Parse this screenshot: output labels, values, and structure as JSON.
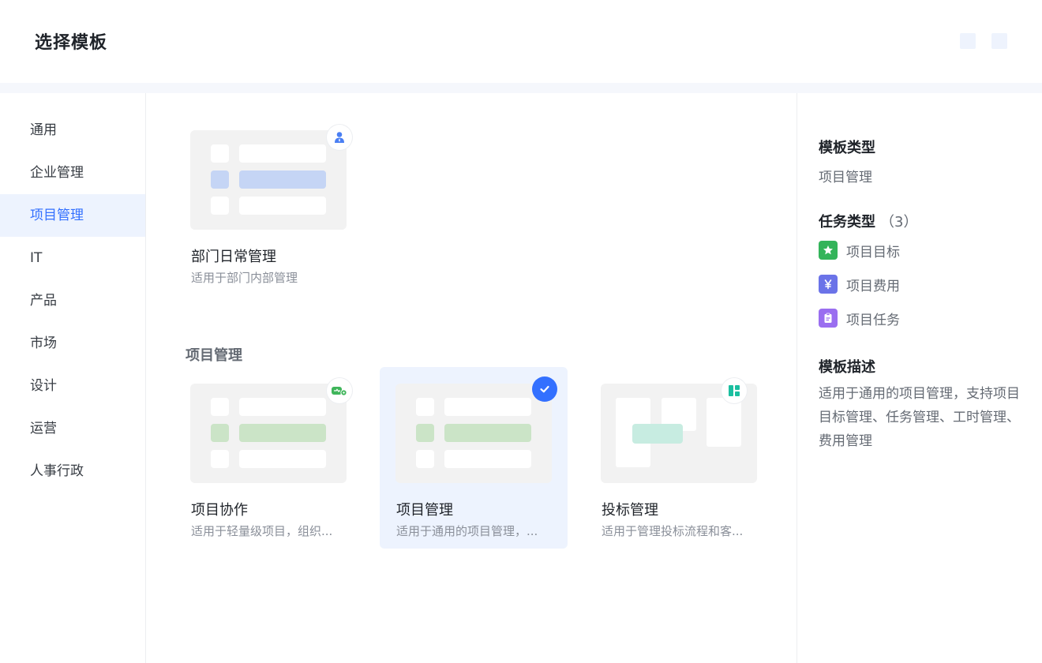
{
  "header": {
    "title": "选择模板"
  },
  "sidebar": {
    "items": [
      {
        "label": "通用",
        "active": false
      },
      {
        "label": "企业管理",
        "active": false
      },
      {
        "label": "项目管理",
        "active": true
      },
      {
        "label": "IT",
        "active": false
      },
      {
        "label": "产品",
        "active": false
      },
      {
        "label": "市场",
        "active": false
      },
      {
        "label": "设计",
        "active": false
      },
      {
        "label": "运营",
        "active": false
      },
      {
        "label": "人事行政",
        "active": false
      }
    ]
  },
  "main": {
    "top_cards": [
      {
        "name": "部门日常管理",
        "desc": "适用于部门内部管理",
        "icon": "person-icon",
        "accent": "#4a7ff3"
      }
    ],
    "section_title": "项目管理",
    "cards": [
      {
        "name": "项目协作",
        "desc": "适用于轻量级项目，组织...",
        "icon": "collab-gear-icon",
        "accent": "#3fb55a",
        "selected": false
      },
      {
        "name": "项目管理",
        "desc": "适用于通用的项目管理，...",
        "icon": "check-icon",
        "accent": "#3370ff",
        "selected": true
      },
      {
        "name": "投标管理",
        "desc": "适用于管理投标流程和客...",
        "icon": "grid-layout-icon",
        "accent": "#1bbfa0",
        "selected": false
      }
    ]
  },
  "detail": {
    "type_label": "模板类型",
    "type_value": "项目管理",
    "task_types_label": "任务类型",
    "task_types_count": "（3）",
    "task_types": [
      {
        "label": "项目目标",
        "icon": "star-icon",
        "color": "#34b45a"
      },
      {
        "label": "项目费用",
        "icon": "yen-icon",
        "color": "#6b73e8"
      },
      {
        "label": "项目任务",
        "icon": "clipboard-icon",
        "color": "#9a6ef0"
      }
    ],
    "desc_label": "模板描述",
    "desc_text": "适用于通用的项目管理，支持项目目标管理、任务管理、工时管理、费用管理"
  }
}
